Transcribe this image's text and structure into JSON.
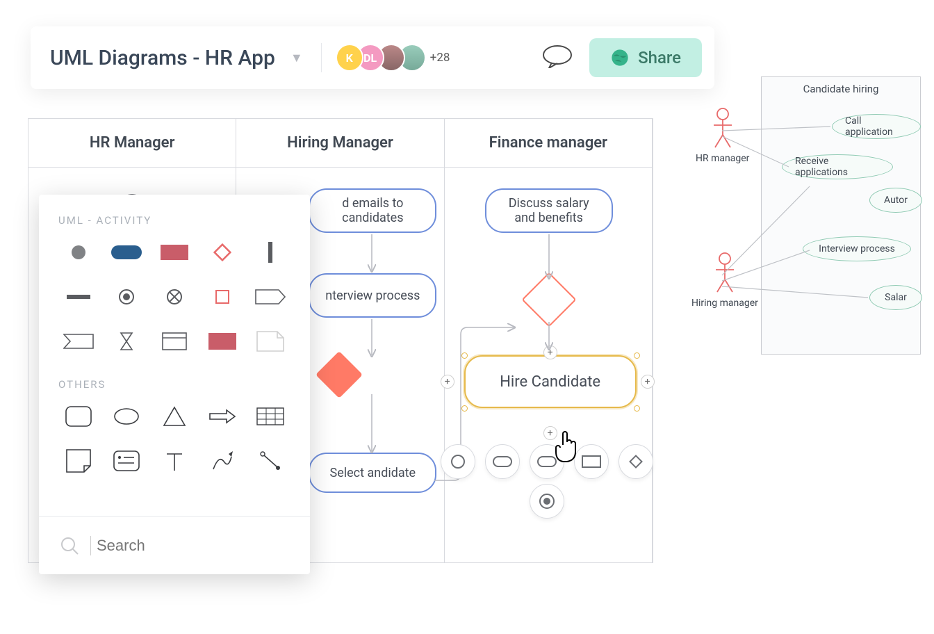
{
  "header": {
    "title": "UML Diagrams - HR App",
    "avatars": [
      "K",
      "DL",
      "",
      ""
    ],
    "more_count": "+28",
    "share_label": "Share"
  },
  "swimlanes": {
    "col1": "HR Manager",
    "col2": "Hiring Manager",
    "col3": "Finance manager"
  },
  "nodes": {
    "emails": "d emails to candidates",
    "interview": "nterview process",
    "select": "Select andidate",
    "discuss": "Discuss salary and benefits",
    "hire": "Hire Candidate"
  },
  "palette": {
    "section1": "UML - ACTIVITY",
    "section2": "OTHERS",
    "search_placeholder": "Search"
  },
  "usecase": {
    "title": "Candidate hiring",
    "actor1": "HR manager",
    "actor2": "Hiring manager",
    "b1": "Call application",
    "b2": "Receive applications",
    "b3": "Autor",
    "b4": "Interview process",
    "b5": "Salar"
  }
}
